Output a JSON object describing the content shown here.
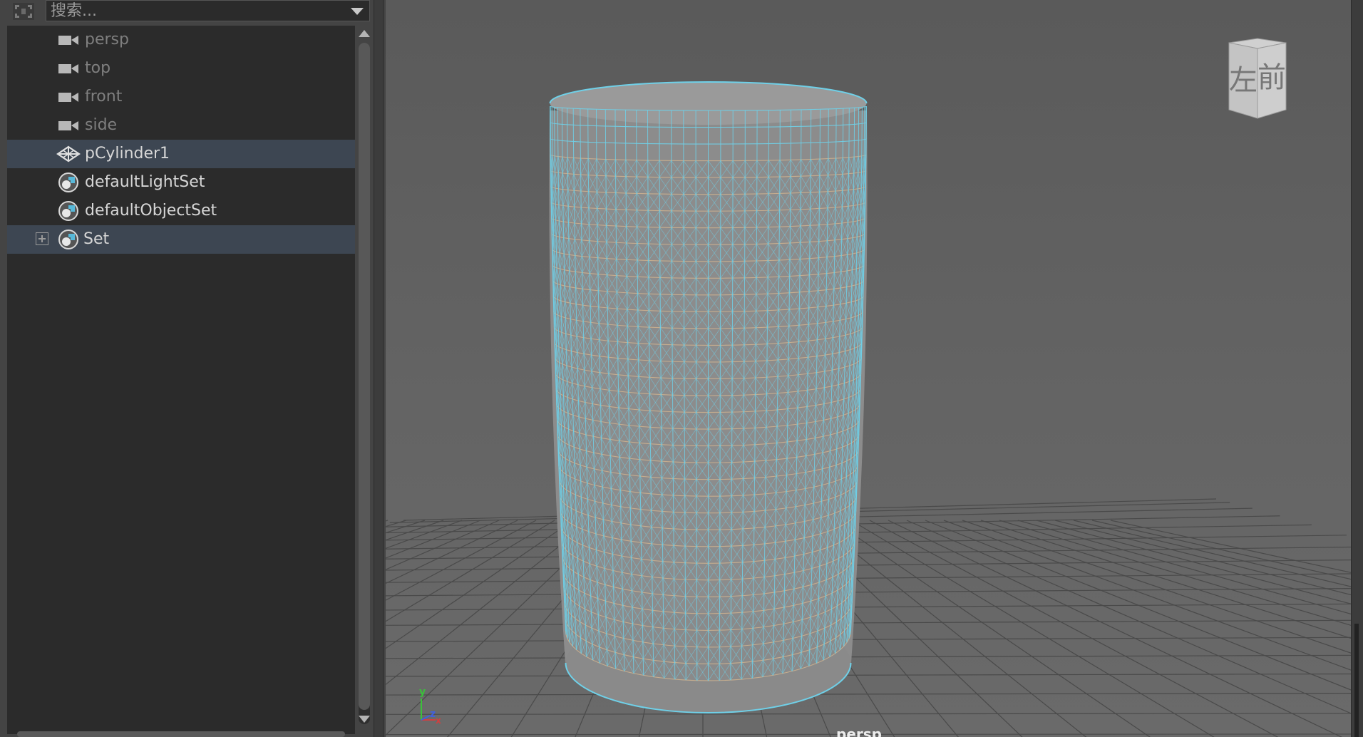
{
  "outliner": {
    "search": {
      "placeholder": "搜索..."
    },
    "items": [
      {
        "label": "persp",
        "icon": "camera-icon",
        "selected": false
      },
      {
        "label": "top",
        "icon": "camera-icon",
        "selected": false
      },
      {
        "label": "front",
        "icon": "camera-icon",
        "selected": false
      },
      {
        "label": "side",
        "icon": "camera-icon",
        "selected": false
      },
      {
        "label": "pCylinder1",
        "icon": "mesh-transform-icon",
        "selected": true
      },
      {
        "label": "defaultLightSet",
        "icon": "set-icon",
        "selected": false
      },
      {
        "label": "defaultObjectSet",
        "icon": "set-icon",
        "selected": false
      },
      {
        "label": "Set",
        "icon": "set-icon",
        "selected": true,
        "expandable": true
      }
    ]
  },
  "viewport": {
    "camera_label": "persp",
    "viewcube": {
      "left_face": "左",
      "front_face": "前"
    },
    "axes": {
      "x": "x",
      "y": "y",
      "z": "z"
    }
  },
  "colors": {
    "wireframe": "#6fd0e8",
    "inner_edges": "#d8b890",
    "selection": "#3d4652",
    "grid": "#4a4a4a"
  }
}
